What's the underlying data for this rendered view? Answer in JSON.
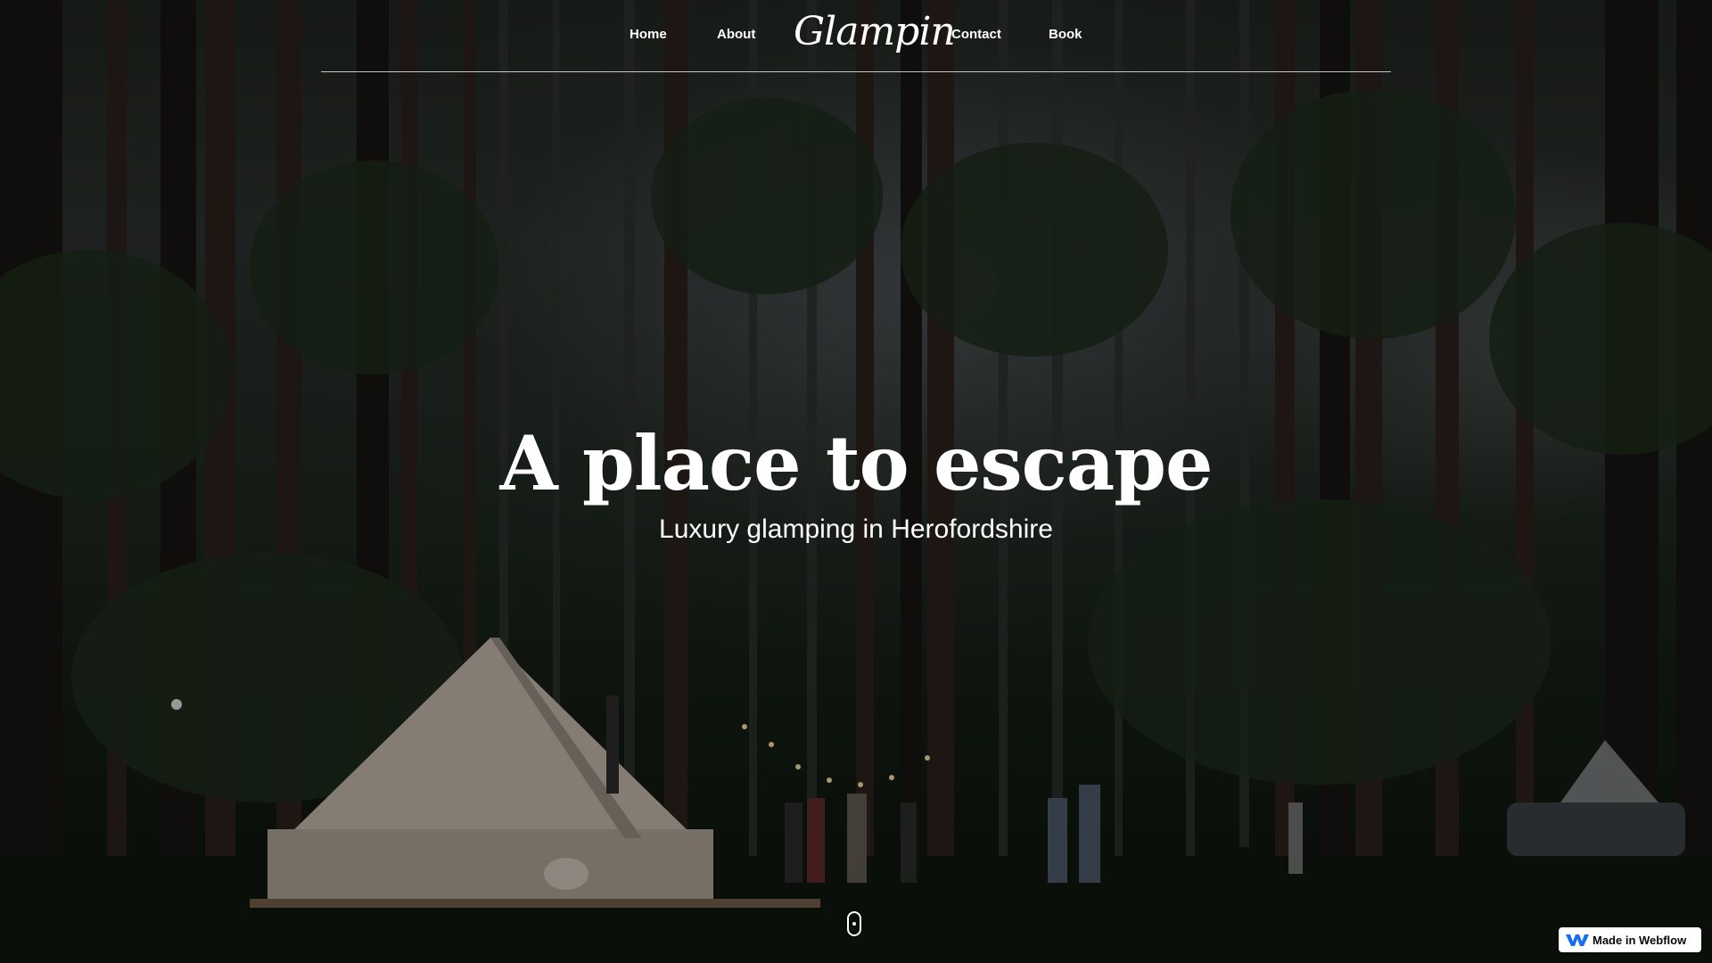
{
  "nav": {
    "links": [
      {
        "label": "Home"
      },
      {
        "label": "About"
      },
      {
        "label": "Contact"
      },
      {
        "label": "Book"
      }
    ],
    "logo_text": "Glampin"
  },
  "hero": {
    "title": "A place to escape",
    "subtitle": "Luxury glamping in Herofordshire"
  },
  "badge": {
    "label": "Made in Webflow",
    "icon": "webflow-logo-icon",
    "color": "#146ef5"
  },
  "scroll_indicator": {
    "icon": "mouse-scroll-icon"
  },
  "colors": {
    "text": "#ffffff",
    "overlay": "#000000"
  }
}
